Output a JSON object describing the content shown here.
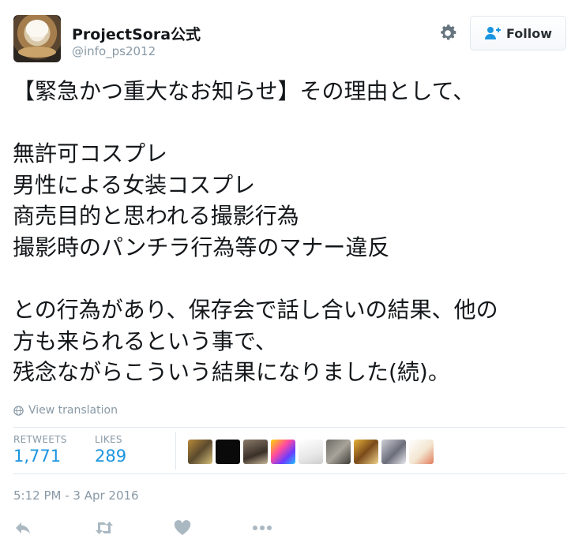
{
  "user": {
    "display_name": "ProjectSora公式",
    "handle": "@info_ps2012"
  },
  "header": {
    "gear_icon": "gear-icon",
    "follow_label": "Follow",
    "follow_icon": "follow-user-plus-icon",
    "accent_color": "#1b95e0"
  },
  "tweet": {
    "text": "【緊急かつ重大なお知らせ】その理由として、\n\n無許可コスプレ\n男性による女装コスプレ\n商売目的と思われる撮影行為\n撮影時のパンチラ行為等のマナー違反\n\nとの行為があり、保存会で話し合いの結果、他の\n方も来られるという事で、\n残念ながらこういう結果になりました(続)。"
  },
  "translation": {
    "label": "View translation",
    "icon": "globe-icon"
  },
  "stats": {
    "retweets_label": "RETWEETS",
    "retweets_count": "1,771",
    "likes_label": "LIKES",
    "likes_count": "289"
  },
  "likers_count_shown": 9,
  "timestamp": "5:12 PM - 3 Apr 2016",
  "actions": [
    {
      "icon": "reply-icon"
    },
    {
      "icon": "retweet-icon"
    },
    {
      "icon": "like-heart-icon"
    },
    {
      "icon": "more-dots-icon"
    }
  ]
}
